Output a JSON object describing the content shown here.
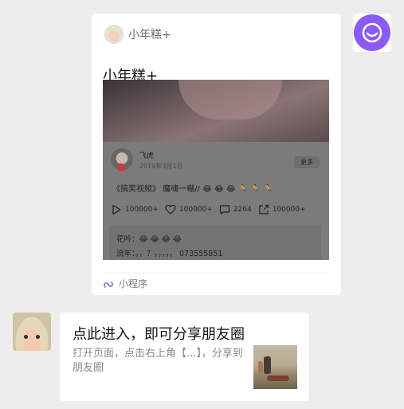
{
  "card": {
    "header_name": "小年糕+",
    "title": "小年糕+",
    "post": {
      "username": "飞虎",
      "date": "2019年3月1日",
      "more_label": "更多",
      "text": "《搞笑视频》 魔魂一嚇// 😂 😂 😂 🏃 🏃 🏃",
      "stats": {
        "plays": "100000+",
        "likes": "100000+",
        "comments": "2264",
        "shares": "100000+"
      },
      "comment1": "花吟：😂 😂 😂 😂",
      "comment2": "流年：。，？，，，，，  073555851"
    },
    "footer_label": "小程序"
  },
  "message": {
    "title": "点此进入，即可分享朋友圈",
    "desc": "打开页面，点击右上角【...】，分享到朋友圈"
  },
  "colors": {
    "background": "#ededed",
    "bot_accent": "#8a5cf5"
  },
  "icons": [
    "smile-icon",
    "play-icon",
    "heart-icon",
    "comment-icon",
    "share-icon",
    "mini-program-icon"
  ]
}
